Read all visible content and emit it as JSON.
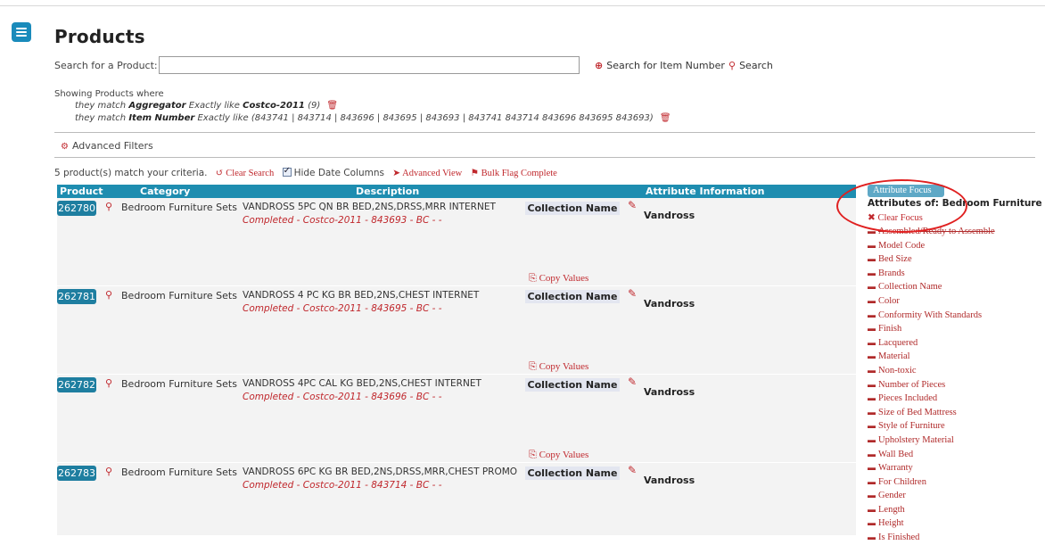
{
  "page": {
    "title": "Products"
  },
  "search": {
    "label": "Search for a Product:",
    "value": "",
    "placeholder": "",
    "item_number_link": "Search for Item Number",
    "search_link": "Search"
  },
  "filters": {
    "showing_label": "Showing Products where",
    "criteria": [
      {
        "prefix": "they match",
        "field": "Aggregator",
        "op": "Exactly like",
        "value": "Costco-2011",
        "count": "(9)"
      },
      {
        "prefix": "they match",
        "field": "Item Number",
        "op": "Exactly like",
        "value": "(843741 | 843714 | 843696 | 843695 | 843693 | 843741 843714 843696 843695 843693)",
        "count": ""
      }
    ],
    "advanced_filters_label": "Advanced Filters"
  },
  "results_bar": {
    "match_text": "5 product(s) match your criteria.",
    "clear_search": "Clear Search",
    "hide_date_columns": "Hide Date Columns",
    "hide_date_checked": true,
    "advanced_view": "Advanced View",
    "bulk_flag": "Bulk Flag Complete"
  },
  "table": {
    "headers": {
      "product": "Product",
      "category": "Category",
      "description": "Description",
      "attribute": "Attribute Information"
    },
    "copy_values_label": "Copy Values",
    "rows": [
      {
        "id": "262780",
        "category": "Bedroom Furniture Sets",
        "description": "VANDROSS 5PC QN BR BED,2NS,DRSS,MRR INTERNET",
        "status": "Completed - Costco-2011 - 843693 - BC - -",
        "attr_name": "Collection Name",
        "attr_value": "Vandross"
      },
      {
        "id": "262781",
        "category": "Bedroom Furniture Sets",
        "description": "VANDROSS 4 PC KG BR BED,2NS,CHEST INTERNET",
        "status": "Completed - Costco-2011 - 843695 - BC - -",
        "attr_name": "Collection Name",
        "attr_value": "Vandross"
      },
      {
        "id": "262782",
        "category": "Bedroom Furniture Sets",
        "description": "VANDROSS 4PC CAL KG BED,2NS,CHEST INTERNET",
        "status": "Completed - Costco-2011 - 843696 - BC - -",
        "attr_name": "Collection Name",
        "attr_value": "Vandross"
      },
      {
        "id": "262783",
        "category": "Bedroom Furniture Sets",
        "description": "VANDROSS 6PC KG BR BED,2NS,DRSS,MRR,CHEST PROMO",
        "status": "Completed - Costco-2011 - 843714 - BC - -",
        "attr_name": "Collection Name",
        "attr_value": "Vandross"
      }
    ]
  },
  "attribute_focus": {
    "tab_label": "Attribute Focus",
    "title": "Attributes of: Bedroom Furniture Sets",
    "clear_focus": "Clear Focus",
    "items": [
      "Assembled/Ready to Assemble",
      "Model Code",
      "Bed Size",
      "Brands",
      "Collection Name",
      "Color",
      "Conformity With Standards",
      "Finish",
      "Lacquered",
      "Material",
      "Non-toxic",
      "Number of Pieces",
      "Pieces Included",
      "Size of Bed Mattress",
      "Style of Furniture",
      "Upholstery Material",
      "Wall Bed",
      "Warranty",
      "For Children",
      "Gender",
      "Length",
      "Height",
      "Is Finished"
    ]
  },
  "colors": {
    "accent_red": "#c0282d",
    "header_blue": "#1e8db0",
    "menu_blue": "#1a8bbb",
    "annotation_circle": "#e02020"
  }
}
